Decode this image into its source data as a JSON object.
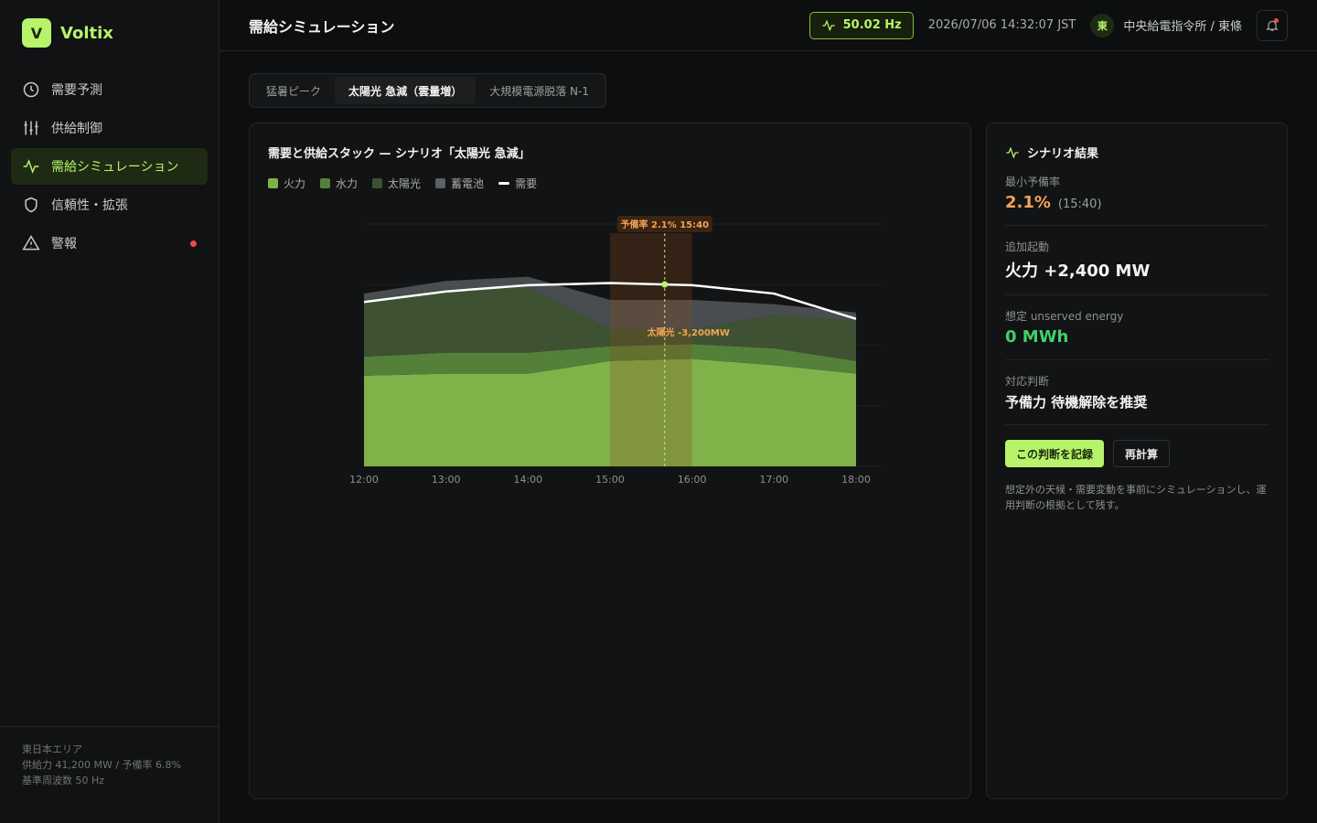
{
  "brand": {
    "logo_letter": "V",
    "name": "Voltix"
  },
  "sidebar": {
    "items": [
      {
        "label": "需要予測",
        "icon": "clock-icon"
      },
      {
        "label": "供給制御",
        "icon": "sliders-icon"
      },
      {
        "label": "需給シミュレーション",
        "icon": "pulse-icon",
        "active": true
      },
      {
        "label": "信頼性・拡張",
        "icon": "shield-icon"
      },
      {
        "label": "警報",
        "icon": "alert-icon",
        "has_dot": true
      }
    ],
    "footer": {
      "area": "東日本エリア",
      "supply": "供給力 41,200 MW / 予備率 6.8%",
      "frequency": "基準周波数 50 Hz"
    }
  },
  "topbar": {
    "title": "需給シミュレーション",
    "hz": "50.02 Hz",
    "timestamp": "2026/07/06 14:32:07 JST",
    "user_initial": "東",
    "user_name": "中央給電指令所 / 東條"
  },
  "tabs": [
    {
      "label": "猛暑ピーク"
    },
    {
      "label": "太陽光 急減（雲量増）",
      "active": true
    },
    {
      "label": "大規模電源脱落 N-1"
    }
  ],
  "chart_card": {
    "title": "需要と供給スタック — シナリオ「太陽光 急減」",
    "legend": [
      {
        "label": "火力",
        "color": "#7fb34a"
      },
      {
        "label": "水力",
        "color": "#55803a"
      },
      {
        "label": "太陽光",
        "color": "#3e5233"
      },
      {
        "label": "蓄電池",
        "color": "#5d6164"
      },
      {
        "label": "需要",
        "color": "#ffffff",
        "is_line": true
      }
    ]
  },
  "chart_data": {
    "type": "area",
    "x": [
      "12:00",
      "13:00",
      "14:00",
      "15:00",
      "16:00",
      "17:00",
      "18:00"
    ],
    "series": [
      {
        "name": "火力",
        "values": [
          0.43,
          0.44,
          0.44,
          0.5,
          0.51,
          0.48,
          0.44
        ],
        "color": "#7fb34a"
      },
      {
        "name": "水力",
        "values": [
          0.09,
          0.1,
          0.1,
          0.07,
          0.07,
          0.08,
          0.06
        ],
        "color": "#55803a"
      },
      {
        "name": "太陽光",
        "values": [
          0.27,
          0.3,
          0.31,
          0.08,
          0.07,
          0.16,
          0.19
        ],
        "color": "#3e5233"
      },
      {
        "name": "蓄電池",
        "values": [
          0.03,
          0.04,
          0.05,
          0.14,
          0.14,
          0.05,
          0.04
        ],
        "color": "#5d6164"
      }
    ],
    "demand": {
      "name": "需要",
      "values": [
        0.78,
        0.83,
        0.86,
        0.87,
        0.86,
        0.82,
        0.7
      ]
    },
    "ylim": [
      0,
      1.15
    ],
    "highlight": {
      "start": "15:00",
      "end": "16:00"
    },
    "marker": {
      "time": "15:40",
      "label": "予備率 2.1% 15:40"
    },
    "annotation": {
      "label": "太陽光 -3,200MW",
      "time": "15:40"
    }
  },
  "result_card": {
    "title": "シナリオ結果",
    "min_reserve_label": "最小予備率",
    "min_reserve_value": "2.1%",
    "min_reserve_time": "(15:40)",
    "extra_start_label": "追加起動",
    "extra_start_value": "火力 +2,400 MW",
    "unserved_label": "想定 unserved energy",
    "unserved_value": "0 MWh",
    "decision_label": "対応判断",
    "decision_value": "予備力 待機解除を推奨",
    "record_button": "この判断を記録",
    "recalc_button": "再計算",
    "note": "想定外の天候・需要変動を事前にシミュレーションし、運用判断の根拠として残す。"
  }
}
